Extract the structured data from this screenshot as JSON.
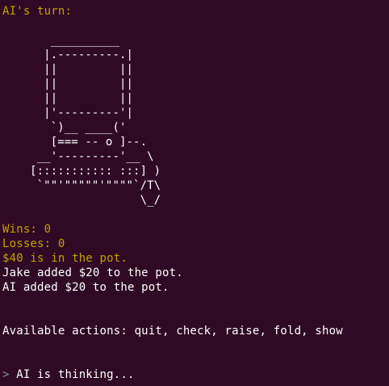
{
  "terminal": {
    "turn_header": "AI's turn:",
    "ascii_art": [
      "       __________",
      "      |.---------.|",
      "      ||         ||",
      "      ||         ||",
      "      ||         ||",
      "      |'---------'|",
      "       `)__ ____('",
      "       [=== -- o ]--.",
      "     __'---------'__ \\",
      "    [::::::::::: :::] )",
      "     `\"\"'\"\"\"\"\"'\"\"\"\"`/T\\",
      "                    \\_/"
    ],
    "stats": {
      "wins": "Wins: 0",
      "losses": "Losses: 0",
      "pot": "$40 is in the pot."
    },
    "events": [
      "Jake added $20 to the pot.",
      "AI added $20 to the pot."
    ],
    "actions_line": "Available actions: quit, check, raise, fold, show",
    "prompt_symbol": ">",
    "status_line": "AI is thinking..."
  },
  "colors": {
    "background": "#300a24",
    "accent_yellow": "#c4a000",
    "text": "#ffffff",
    "prompt": "#8a8a9a"
  }
}
